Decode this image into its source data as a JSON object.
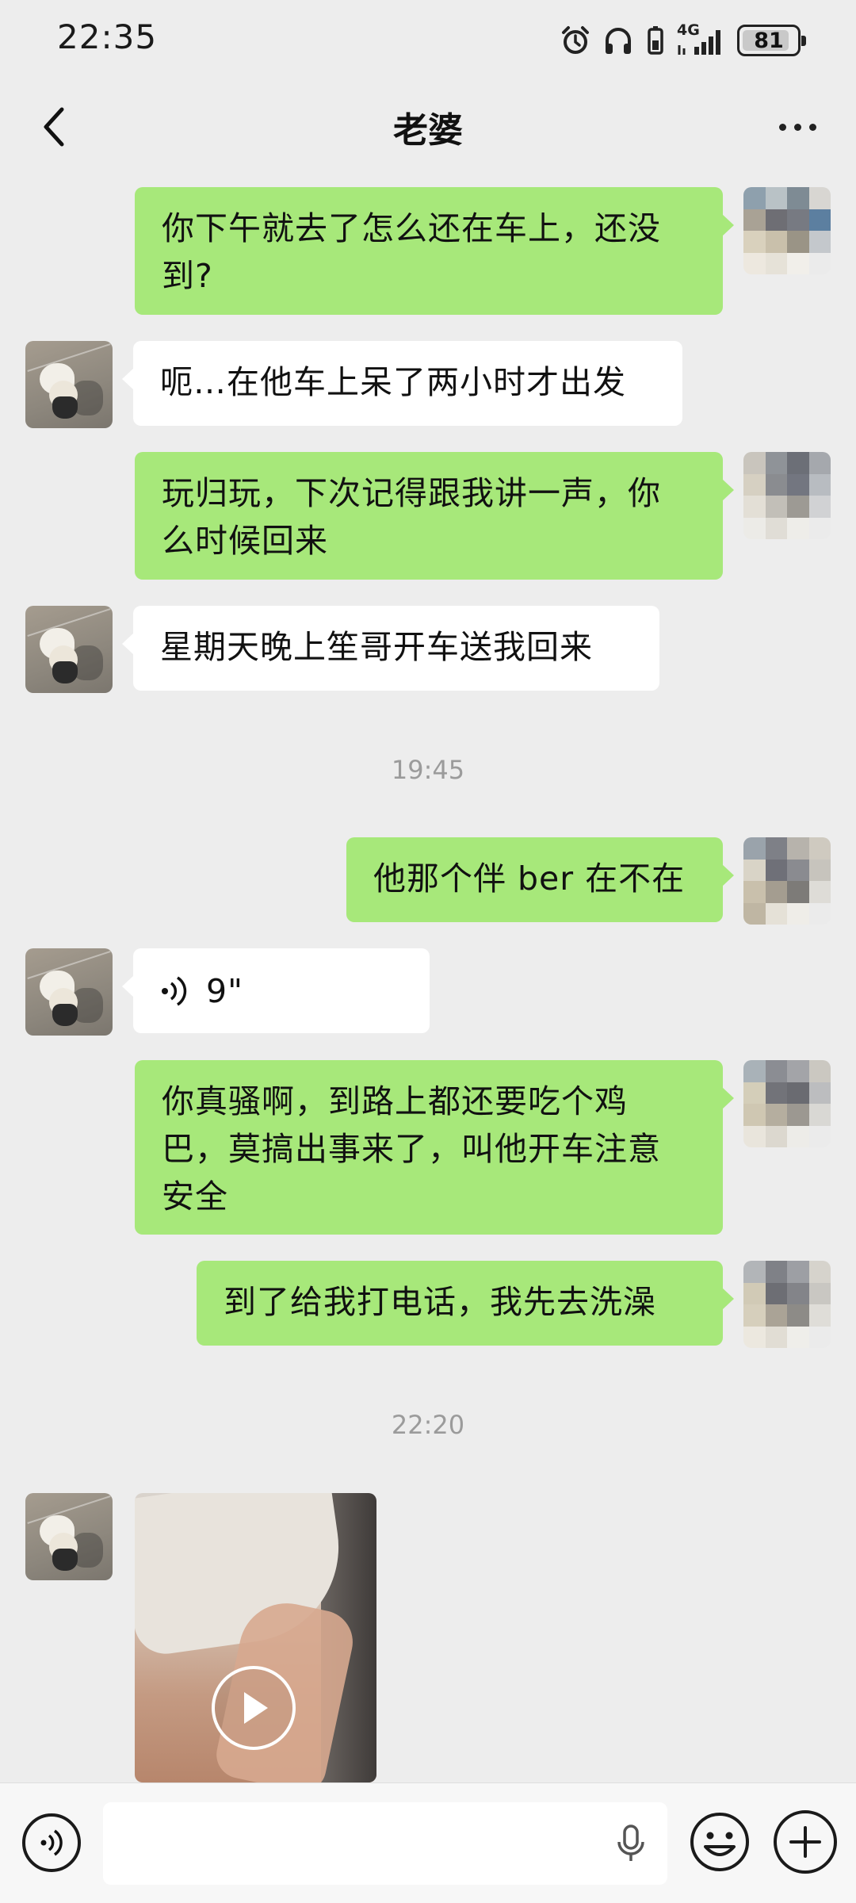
{
  "status_bar": {
    "time": "22:35",
    "network": "4G",
    "battery": 81,
    "battery_label": "81",
    "icons": [
      "alarm-icon",
      "headphones-icon",
      "vibrate-icon",
      "signal-icon",
      "battery-icon"
    ]
  },
  "header": {
    "title": "老婆",
    "back_icon": "chevron-left-icon",
    "more_icon": "more-icon"
  },
  "messages": [
    {
      "from": "me",
      "type": "text",
      "lines": [
        "你下午就去了怎么还在车上，还没",
        "到?"
      ]
    },
    {
      "from": "her",
      "type": "text",
      "lines": [
        "呃…在他车上呆了两小时才出发"
      ]
    },
    {
      "from": "me",
      "type": "text",
      "lines": [
        "玩归玩，下次记得跟我讲一声，你",
        "么时候回来"
      ]
    },
    {
      "from": "her",
      "type": "text",
      "lines": [
        "星期天晚上笙哥开车送我回来"
      ]
    },
    {
      "type": "timestamp",
      "text": "19:45"
    },
    {
      "from": "me",
      "type": "text",
      "lines": [
        "他那个伴 ber 在不在"
      ]
    },
    {
      "from": "her",
      "type": "voice",
      "duration": "9\""
    },
    {
      "from": "me",
      "type": "text",
      "lines": [
        "你真骚啊，到路上都还要吃个鸡",
        "巴，莫搞出事来了，叫他开车注意",
        "安全"
      ]
    },
    {
      "from": "me",
      "type": "text",
      "lines": [
        "到了给我打电话，我先去洗澡"
      ]
    },
    {
      "type": "timestamp",
      "text": "22:20"
    },
    {
      "from": "her",
      "type": "video"
    }
  ],
  "input_bar": {
    "voice_icon": "voice-mode-icon",
    "mic_icon": "microphone-icon",
    "emoji_icon": "emoji-icon",
    "plus_icon": "plus-icon",
    "value": "",
    "placeholder": ""
  },
  "colors": {
    "background": "#ededed",
    "outgoing_bubble": "#a7e87a",
    "incoming_bubble": "#ffffff",
    "timestamp_text": "#9b9b9b"
  }
}
